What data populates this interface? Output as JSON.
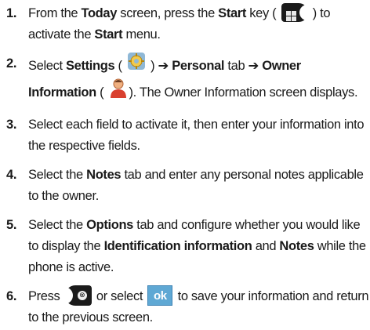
{
  "steps": [
    {
      "number": "1.",
      "text1": "From the ",
      "bold1": "Today",
      "text2": " screen, press the ",
      "bold2": "Start",
      "text3": " key ( ",
      "text4": " ) to activate the ",
      "bold3": "Start",
      "text5": " menu."
    },
    {
      "number": "2.",
      "text1": "Select ",
      "bold1": "Settings",
      "text2": " ( ",
      "text3": " ) ➔ ",
      "bold2": "Personal",
      "text4": " tab ➔ ",
      "bold3": "Owner Information",
      "text5": " ( ",
      "text6": "). The Owner Information screen displays."
    },
    {
      "number": "3.",
      "text": "Select each field to activate it, then enter your information into the respective fields."
    },
    {
      "number": "4.",
      "text1": "Select the ",
      "bold1": "Notes",
      "text2": " tab and enter any personal notes applicable to the owner."
    },
    {
      "number": "5.",
      "text1": "Select the ",
      "bold1": "Options",
      "text2": " tab and configure whether you would like to display the ",
      "bold2": "Identification information",
      "text3": " and ",
      "bold3": "Notes",
      "text4": " while the phone is active."
    },
    {
      "number": "6.",
      "text1": "Press ",
      "text2": " or select ",
      "ok_label": "ok",
      "text3": " to save your information and return to the previous screen."
    }
  ],
  "icons": {
    "start_key": "windows-start-key-icon",
    "settings": "settings-gear-icon",
    "owner_information": "owner-person-icon",
    "back_key": "back-key-icon",
    "ok_button": "ok-button-icon"
  },
  "colors": {
    "text": "#1a1a1a",
    "ok_button": "#5fa8d4"
  }
}
